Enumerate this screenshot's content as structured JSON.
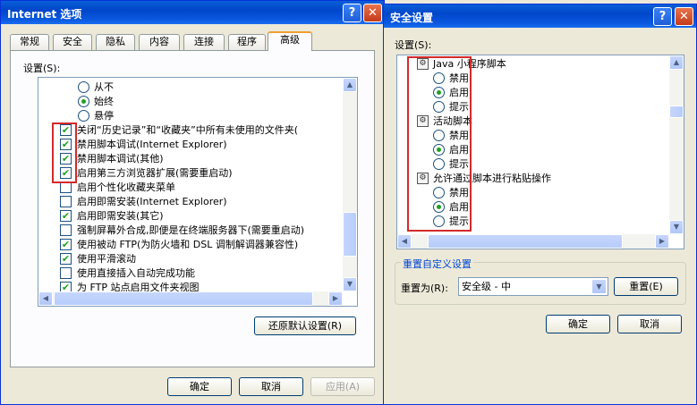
{
  "left_window": {
    "title": "Internet 选项",
    "tabs": [
      "常规",
      "安全",
      "隐私",
      "内容",
      "连接",
      "程序",
      "高级"
    ],
    "settings_label": "设置(S):",
    "items": [
      {
        "type": "radio",
        "checked": false,
        "label": "从不"
      },
      {
        "type": "radio",
        "checked": true,
        "label": "始终"
      },
      {
        "type": "radio",
        "checked": false,
        "label": "悬停"
      },
      {
        "type": "check",
        "checked": true,
        "label": "关闭“历史记录”和“收藏夹”中所有未使用的文件夹("
      },
      {
        "type": "check",
        "checked": true,
        "label": "禁用脚本调试(Internet Explorer)"
      },
      {
        "type": "check",
        "checked": true,
        "label": "禁用脚本调试(其他)"
      },
      {
        "type": "check",
        "checked": true,
        "label": "启用第三方浏览器扩展(需要重启动)"
      },
      {
        "type": "check",
        "checked": false,
        "label": "启用个性化收藏夹菜单"
      },
      {
        "type": "check",
        "checked": false,
        "label": "启用即需安装(Internet Explorer)"
      },
      {
        "type": "check",
        "checked": true,
        "label": "启用即需安装(其它)"
      },
      {
        "type": "check",
        "checked": false,
        "label": "强制屏幕外合成,即便是在终端服务器下(需要重启动)"
      },
      {
        "type": "check",
        "checked": true,
        "label": "使用被动 FTP(为防火墙和 DSL 调制解调器兼容性)"
      },
      {
        "type": "check",
        "checked": true,
        "label": "使用平滑滚动"
      },
      {
        "type": "check",
        "checked": false,
        "label": "使用直接插入自动完成功能"
      },
      {
        "type": "check",
        "checked": true,
        "label": "为 FTP 站点启用文件夹视图"
      }
    ],
    "restore_button": "还原默认设置(R)",
    "ok": "确定",
    "cancel": "取消",
    "apply": "应用(A)"
  },
  "right_window": {
    "title": "安全设置",
    "settings_label": "设置(S):",
    "items": [
      {
        "type": "section",
        "label": "Java 小程序脚本"
      },
      {
        "type": "radio",
        "checked": false,
        "label": "禁用"
      },
      {
        "type": "radio",
        "checked": true,
        "label": "启用"
      },
      {
        "type": "radio",
        "checked": false,
        "label": "提示"
      },
      {
        "type": "section",
        "label": "活动脚本"
      },
      {
        "type": "radio",
        "checked": false,
        "label": "禁用"
      },
      {
        "type": "radio",
        "checked": true,
        "label": "启用"
      },
      {
        "type": "radio",
        "checked": false,
        "label": "提示"
      },
      {
        "type": "section",
        "label": "允许通过脚本进行粘贴操作"
      },
      {
        "type": "radio",
        "checked": false,
        "label": "禁用"
      },
      {
        "type": "radio",
        "checked": true,
        "label": "启用"
      },
      {
        "type": "radio",
        "checked": false,
        "label": "提示"
      }
    ],
    "reset_group": "重置自定义设置",
    "reset_to_label": "重置为(R):",
    "reset_select_value": "安全级 - 中",
    "reset_button": "重置(E)",
    "ok": "确定",
    "cancel": "取消"
  }
}
